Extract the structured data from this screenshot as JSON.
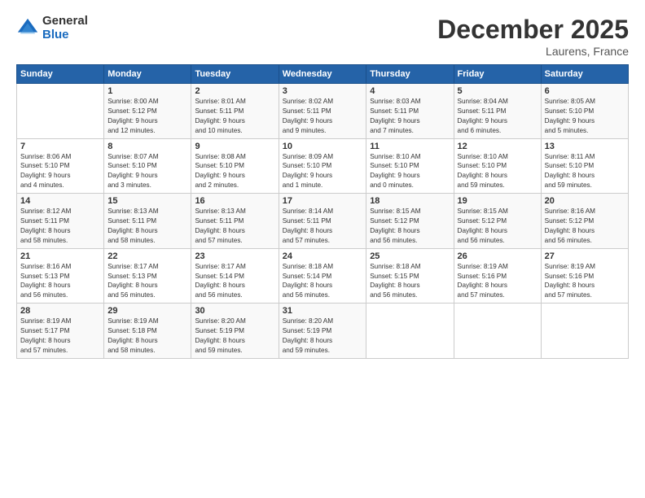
{
  "logo": {
    "general": "General",
    "blue": "Blue"
  },
  "header": {
    "month": "December 2025",
    "location": "Laurens, France"
  },
  "weekdays": [
    "Sunday",
    "Monday",
    "Tuesday",
    "Wednesday",
    "Thursday",
    "Friday",
    "Saturday"
  ],
  "weeks": [
    [
      {
        "day": "",
        "info": ""
      },
      {
        "day": "1",
        "info": "Sunrise: 8:00 AM\nSunset: 5:12 PM\nDaylight: 9 hours\nand 12 minutes."
      },
      {
        "day": "2",
        "info": "Sunrise: 8:01 AM\nSunset: 5:11 PM\nDaylight: 9 hours\nand 10 minutes."
      },
      {
        "day": "3",
        "info": "Sunrise: 8:02 AM\nSunset: 5:11 PM\nDaylight: 9 hours\nand 9 minutes."
      },
      {
        "day": "4",
        "info": "Sunrise: 8:03 AM\nSunset: 5:11 PM\nDaylight: 9 hours\nand 7 minutes."
      },
      {
        "day": "5",
        "info": "Sunrise: 8:04 AM\nSunset: 5:11 PM\nDaylight: 9 hours\nand 6 minutes."
      },
      {
        "day": "6",
        "info": "Sunrise: 8:05 AM\nSunset: 5:10 PM\nDaylight: 9 hours\nand 5 minutes."
      }
    ],
    [
      {
        "day": "7",
        "info": "Sunrise: 8:06 AM\nSunset: 5:10 PM\nDaylight: 9 hours\nand 4 minutes."
      },
      {
        "day": "8",
        "info": "Sunrise: 8:07 AM\nSunset: 5:10 PM\nDaylight: 9 hours\nand 3 minutes."
      },
      {
        "day": "9",
        "info": "Sunrise: 8:08 AM\nSunset: 5:10 PM\nDaylight: 9 hours\nand 2 minutes."
      },
      {
        "day": "10",
        "info": "Sunrise: 8:09 AM\nSunset: 5:10 PM\nDaylight: 9 hours\nand 1 minute."
      },
      {
        "day": "11",
        "info": "Sunrise: 8:10 AM\nSunset: 5:10 PM\nDaylight: 9 hours\nand 0 minutes."
      },
      {
        "day": "12",
        "info": "Sunrise: 8:10 AM\nSunset: 5:10 PM\nDaylight: 8 hours\nand 59 minutes."
      },
      {
        "day": "13",
        "info": "Sunrise: 8:11 AM\nSunset: 5:10 PM\nDaylight: 8 hours\nand 59 minutes."
      }
    ],
    [
      {
        "day": "14",
        "info": "Sunrise: 8:12 AM\nSunset: 5:11 PM\nDaylight: 8 hours\nand 58 minutes."
      },
      {
        "day": "15",
        "info": "Sunrise: 8:13 AM\nSunset: 5:11 PM\nDaylight: 8 hours\nand 58 minutes."
      },
      {
        "day": "16",
        "info": "Sunrise: 8:13 AM\nSunset: 5:11 PM\nDaylight: 8 hours\nand 57 minutes."
      },
      {
        "day": "17",
        "info": "Sunrise: 8:14 AM\nSunset: 5:11 PM\nDaylight: 8 hours\nand 57 minutes."
      },
      {
        "day": "18",
        "info": "Sunrise: 8:15 AM\nSunset: 5:12 PM\nDaylight: 8 hours\nand 56 minutes."
      },
      {
        "day": "19",
        "info": "Sunrise: 8:15 AM\nSunset: 5:12 PM\nDaylight: 8 hours\nand 56 minutes."
      },
      {
        "day": "20",
        "info": "Sunrise: 8:16 AM\nSunset: 5:12 PM\nDaylight: 8 hours\nand 56 minutes."
      }
    ],
    [
      {
        "day": "21",
        "info": "Sunrise: 8:16 AM\nSunset: 5:13 PM\nDaylight: 8 hours\nand 56 minutes."
      },
      {
        "day": "22",
        "info": "Sunrise: 8:17 AM\nSunset: 5:13 PM\nDaylight: 8 hours\nand 56 minutes."
      },
      {
        "day": "23",
        "info": "Sunrise: 8:17 AM\nSunset: 5:14 PM\nDaylight: 8 hours\nand 56 minutes."
      },
      {
        "day": "24",
        "info": "Sunrise: 8:18 AM\nSunset: 5:14 PM\nDaylight: 8 hours\nand 56 minutes."
      },
      {
        "day": "25",
        "info": "Sunrise: 8:18 AM\nSunset: 5:15 PM\nDaylight: 8 hours\nand 56 minutes."
      },
      {
        "day": "26",
        "info": "Sunrise: 8:19 AM\nSunset: 5:16 PM\nDaylight: 8 hours\nand 57 minutes."
      },
      {
        "day": "27",
        "info": "Sunrise: 8:19 AM\nSunset: 5:16 PM\nDaylight: 8 hours\nand 57 minutes."
      }
    ],
    [
      {
        "day": "28",
        "info": "Sunrise: 8:19 AM\nSunset: 5:17 PM\nDaylight: 8 hours\nand 57 minutes."
      },
      {
        "day": "29",
        "info": "Sunrise: 8:19 AM\nSunset: 5:18 PM\nDaylight: 8 hours\nand 58 minutes."
      },
      {
        "day": "30",
        "info": "Sunrise: 8:20 AM\nSunset: 5:19 PM\nDaylight: 8 hours\nand 59 minutes."
      },
      {
        "day": "31",
        "info": "Sunrise: 8:20 AM\nSunset: 5:19 PM\nDaylight: 8 hours\nand 59 minutes."
      },
      {
        "day": "",
        "info": ""
      },
      {
        "day": "",
        "info": ""
      },
      {
        "day": "",
        "info": ""
      }
    ]
  ]
}
